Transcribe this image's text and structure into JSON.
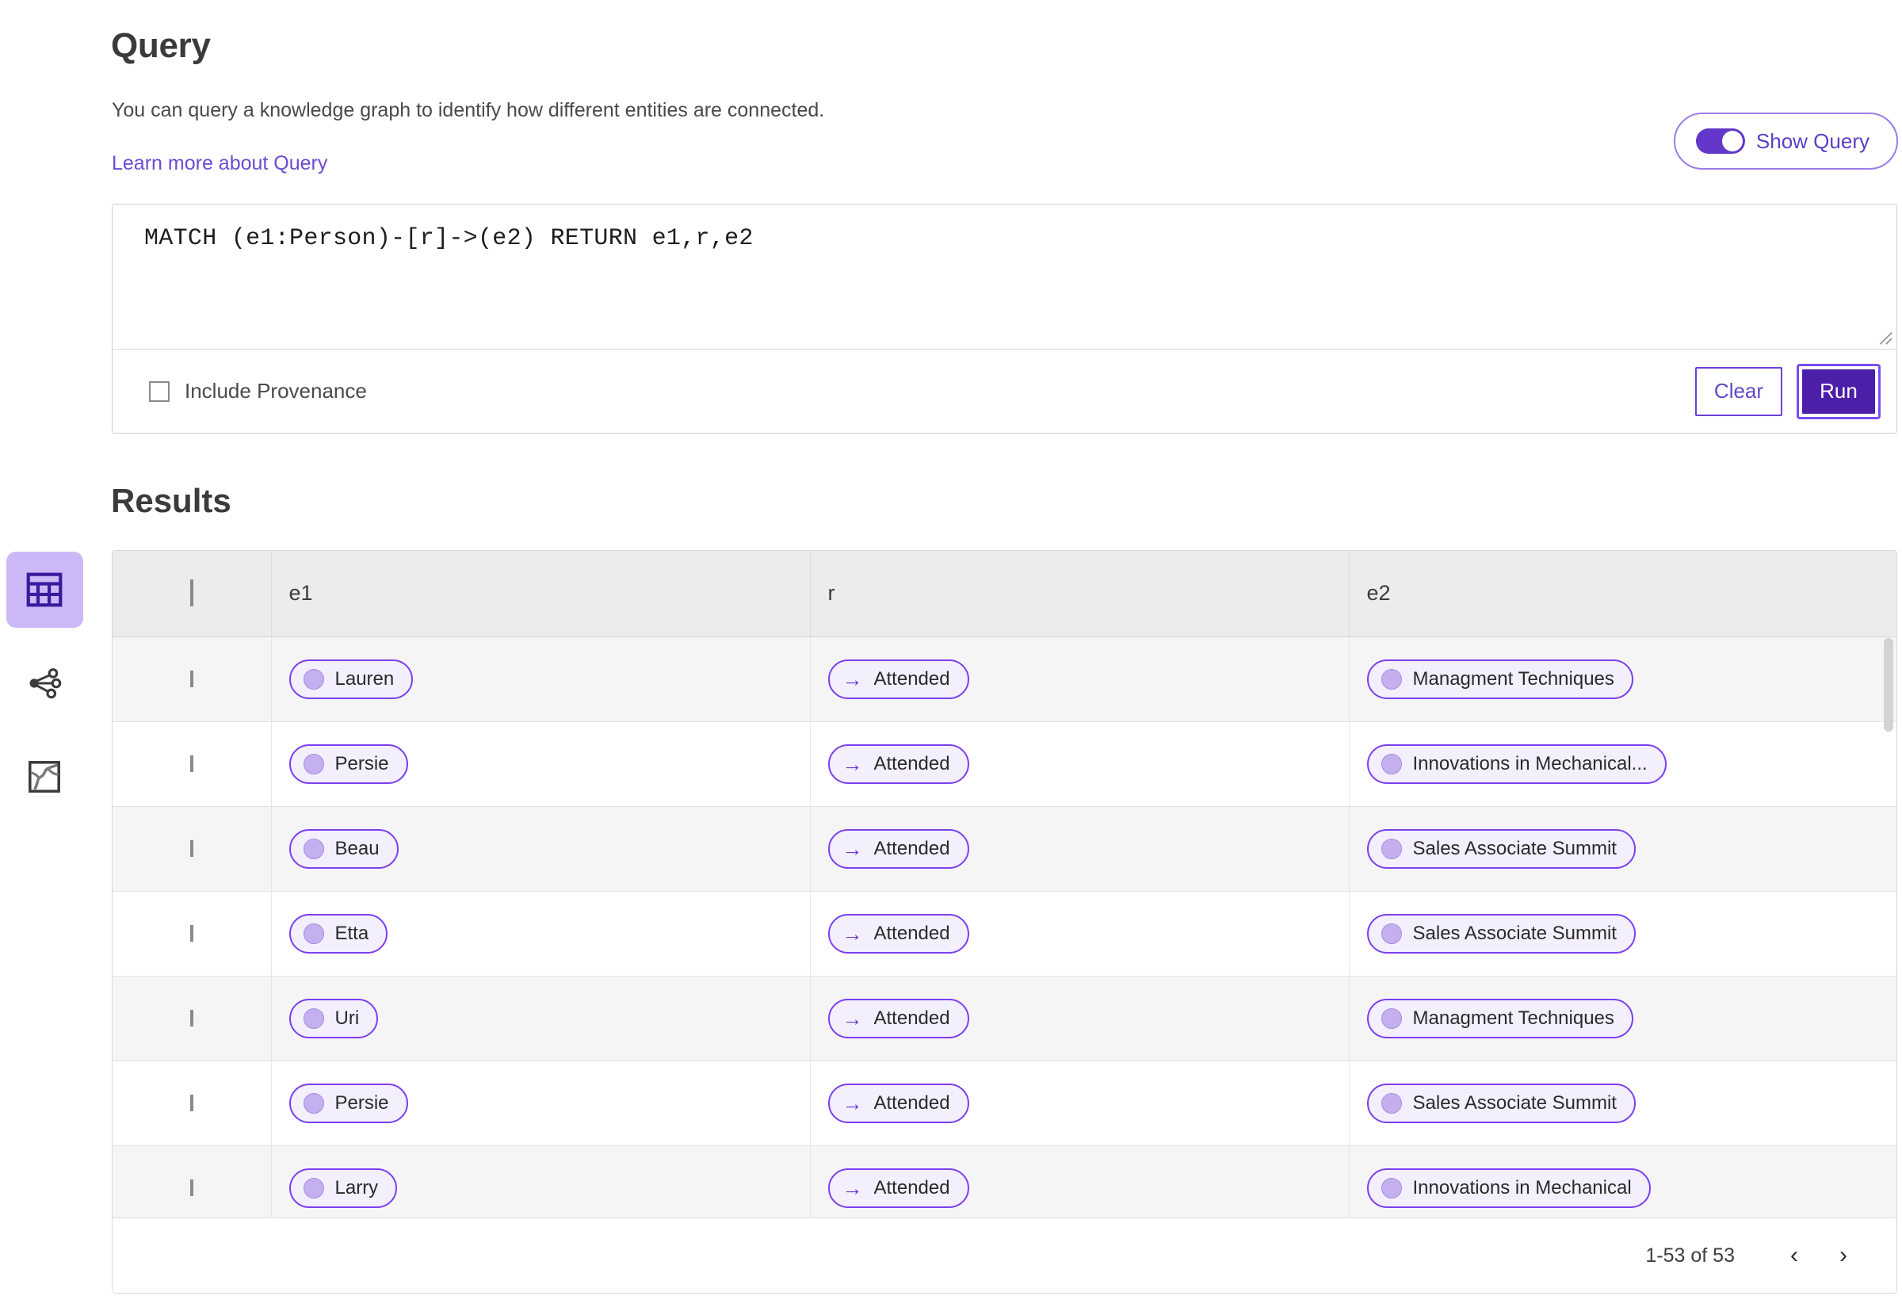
{
  "header": {
    "title": "Query",
    "description": "You can query a knowledge graph to identify how different entities are connected.",
    "learn_more_link": "Learn more about Query"
  },
  "toggle": {
    "label": "Show Query",
    "state": "on"
  },
  "editor": {
    "query_text": "MATCH (e1:Person)-[r]->(e2) RETURN e1,r,e2",
    "include_provenance_label": "Include Provenance",
    "include_provenance_checked": false,
    "clear_label": "Clear",
    "run_label": "Run"
  },
  "results": {
    "title": "Results",
    "columns": [
      "e1",
      "r",
      "e2"
    ],
    "rows": [
      {
        "e1": "Lauren",
        "r": "Attended",
        "e2": "Managment Techniques"
      },
      {
        "e1": "Persie",
        "r": "Attended",
        "e2": "Innovations in Mechanical..."
      },
      {
        "e1": "Beau",
        "r": "Attended",
        "e2": "Sales Associate Summit"
      },
      {
        "e1": "Etta",
        "r": "Attended",
        "e2": "Sales Associate Summit"
      },
      {
        "e1": "Uri",
        "r": "Attended",
        "e2": "Managment Techniques"
      },
      {
        "e1": "Persie",
        "r": "Attended",
        "e2": "Sales Associate Summit"
      },
      {
        "e1": "Larry",
        "r": "Attended",
        "e2": "Innovations in Mechanical"
      }
    ],
    "pagination": {
      "range": "1-53 of 53",
      "prev": "‹",
      "next": "›"
    }
  },
  "sidebar": {
    "items": [
      {
        "name": "table-view",
        "active": true
      },
      {
        "name": "graph-view",
        "active": false
      },
      {
        "name": "map-view",
        "active": false
      }
    ]
  },
  "colors": {
    "accent": "#6237c9",
    "accent_dark": "#4b1fa8",
    "chip_border": "#7b3ff0",
    "chip_bg": "#f3effd",
    "chip_dot": "#c4b0ef",
    "rail_active_bg": "#cdb8f7",
    "header_bg": "#ececec",
    "row_alt_bg": "#f5f5f5"
  },
  "icons": {
    "arrow": "→"
  }
}
